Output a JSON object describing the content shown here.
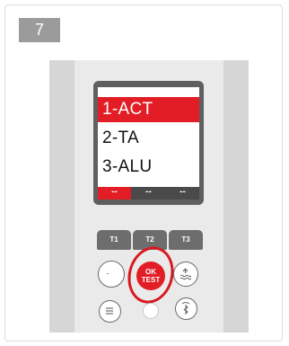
{
  "step": {
    "number": "7"
  },
  "screen": {
    "menu_items": [
      {
        "label": "1-ACT",
        "selected": true
      },
      {
        "label": "2-TA",
        "selected": false
      },
      {
        "label": "3-ALU",
        "selected": false
      }
    ],
    "tabs": [
      {
        "label": "--",
        "active": true
      },
      {
        "label": "--",
        "active": false
      },
      {
        "label": "--",
        "active": false
      }
    ]
  },
  "keypad": {
    "t_keys": [
      "T1",
      "T2",
      "T3"
    ],
    "ok_key": {
      "line1": "OK",
      "line2": "TEST"
    }
  },
  "colors": {
    "accent_red": "#e21d26",
    "badge_gray": "#9b9b9b",
    "screen_frame": "#5f5f5f"
  }
}
